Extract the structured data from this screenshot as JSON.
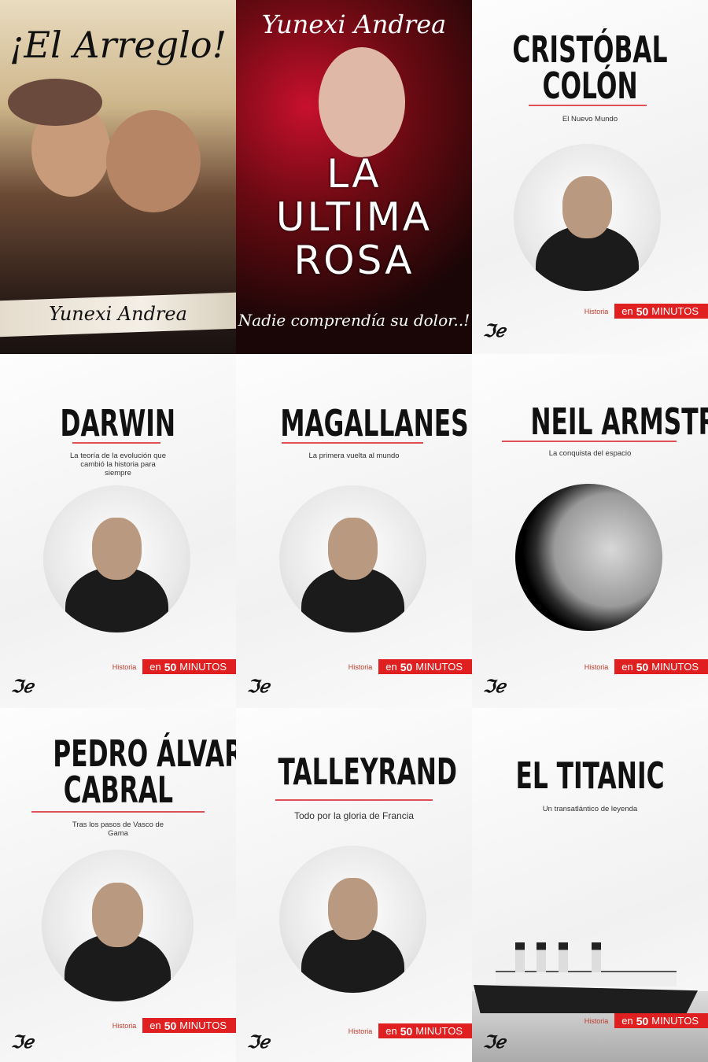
{
  "books": [
    {
      "type": "photo1",
      "script_title": "¡El Arreglo!",
      "author": "Yunexi Andrea"
    },
    {
      "type": "photo2",
      "author": "Yunexi Andrea",
      "title_lines": [
        "LA",
        "ULTIMA",
        "ROSA"
      ],
      "tagline": "Nadie comprendía su dolor..!"
    },
    {
      "type": "series",
      "title_lines": [
        "CRISTÓBAL",
        "COLÓN"
      ],
      "subtitle": "El Nuevo Mundo",
      "category": "Historia",
      "badge_prefix": "en",
      "badge_number": "50",
      "badge_suffix": "MINUTOS",
      "portrait": "portrait"
    },
    {
      "type": "series",
      "title_lines": [
        "DARWIN"
      ],
      "subtitle": "La teoría de la evolución que cambió la historia para siempre",
      "category": "Historia",
      "badge_prefix": "en",
      "badge_number": "50",
      "badge_suffix": "MINUTOS",
      "portrait": "portrait"
    },
    {
      "type": "series",
      "title_lines": [
        "MAGALLANES"
      ],
      "subtitle": "La primera vuelta al mundo",
      "category": "Historia",
      "badge_prefix": "en",
      "badge_number": "50",
      "badge_suffix": "MINUTOS",
      "portrait": "portrait"
    },
    {
      "type": "series",
      "title_lines": [
        "NEIL ARMSTRONG"
      ],
      "subtitle": "La conquista del espacio",
      "category": "Historia",
      "badge_prefix": "en",
      "badge_number": "50",
      "badge_suffix": "MINUTOS",
      "portrait": "moon"
    },
    {
      "type": "series",
      "title_lines": [
        "PEDRO ÁLVARES",
        "CABRAL"
      ],
      "subtitle": "Tras los pasos de Vasco de Gama",
      "category": "Historia",
      "badge_prefix": "en",
      "badge_number": "50",
      "badge_suffix": "MINUTOS",
      "portrait": "portrait"
    },
    {
      "type": "series",
      "title_lines": [
        "TALLEYRAND"
      ],
      "subtitle": "Todo por la gloria de Francia",
      "category": "Historia",
      "badge_prefix": "en",
      "badge_number": "50",
      "badge_suffix": "MINUTOS",
      "portrait": "portrait"
    },
    {
      "type": "series",
      "title_lines": [
        "EL TITANIC"
      ],
      "subtitle": "Un transatlántico de leyenda",
      "category": "Historia",
      "badge_prefix": "en",
      "badge_number": "50",
      "badge_suffix": "MINUTOS",
      "portrait": "ship"
    }
  ],
  "publisher_logo": "ℑℯ",
  "colors": {
    "accent": "#e02020",
    "rule": "#d9262a"
  }
}
